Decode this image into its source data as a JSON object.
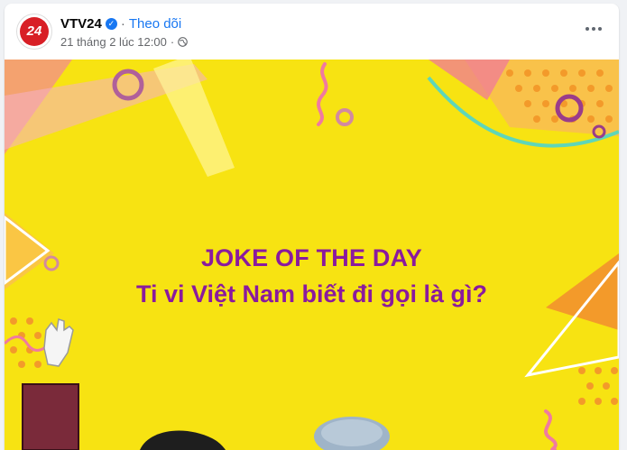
{
  "post": {
    "page_name": "VTV24",
    "avatar_text": "24",
    "follow_label": "Theo dõi",
    "separator": "·",
    "timestamp": "21 tháng 2 lúc 12:00",
    "privacy_icon": "globe-icon",
    "more_icon": "more-options-icon",
    "verified_icon": "verified-badge-icon"
  },
  "image": {
    "title": "JOKE OF THE DAY",
    "question": "Ti vi Việt Nam biết đi gọi là gì?"
  },
  "colors": {
    "accent": "#1877f2",
    "brand_red": "#d81f26",
    "image_background": "#f7e312",
    "text_purple": "#8a1a9e"
  }
}
